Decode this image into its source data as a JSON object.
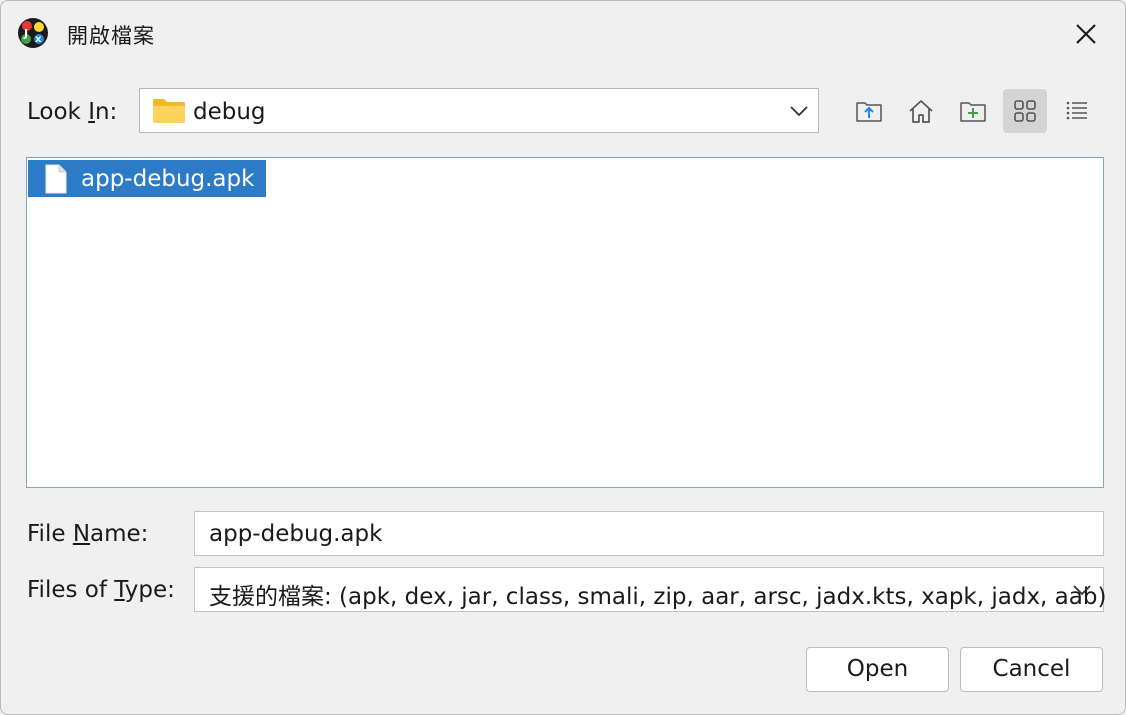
{
  "window": {
    "title": "開啟檔案"
  },
  "look_in": {
    "label_before": "Look ",
    "label_underline": "I",
    "label_after": "n:",
    "value": "debug"
  },
  "toolbar": {
    "icons": [
      "up-folder-icon",
      "home-icon",
      "new-folder-icon",
      "grid-view-icon",
      "list-view-icon"
    ],
    "active": "grid-view-icon"
  },
  "files": [
    {
      "name": "app-debug.apk",
      "selected": true
    }
  ],
  "file_name": {
    "label_before": "File ",
    "label_underline": "N",
    "label_after": "ame:",
    "value": "app-debug.apk"
  },
  "file_type": {
    "label_before": "Files of ",
    "label_underline": "T",
    "label_after": "ype:",
    "value": "支援的檔案: (apk, dex, jar, class, smali, zip, aar, arsc, jadx.kts, xapk, jadx, aab)"
  },
  "buttons": {
    "open": "Open",
    "cancel": "Cancel"
  },
  "colors": {
    "selection": "#2c7bc7",
    "list_border": "#7fa6c9",
    "folder": "#f7c84a"
  }
}
